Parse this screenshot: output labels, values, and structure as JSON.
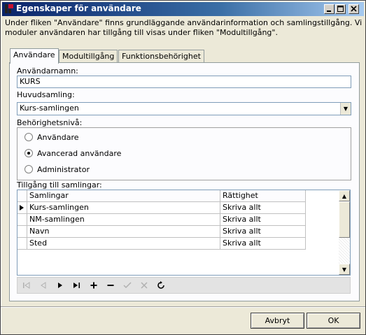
{
  "window": {
    "title": "Egenskaper för användare",
    "description_lines": [
      "Under fliken \"Användare\" finns grundläggande användarinformation och samlingstillgång. Vilka",
      "moduler användaren har tillgång till visas under fliken \"Modultillgång\"."
    ]
  },
  "tabs": [
    {
      "label": "Användare",
      "active": true
    },
    {
      "label": "Modultillgång",
      "active": false
    },
    {
      "label": "Funktionsbehörighet",
      "active": false
    }
  ],
  "form": {
    "username_label": "Användarnamn:",
    "username_value": "KURS",
    "main_collection_label": "Huvudsamling:",
    "main_collection_value": "Kurs-samlingen",
    "permission_label": "Behörighetsnivå:",
    "permission_options": [
      {
        "label": "Användare",
        "checked": false
      },
      {
        "label": "Avancerad användare",
        "checked": true
      },
      {
        "label": "Administrator",
        "checked": false
      }
    ],
    "access_label": "Tillgång till samlingar:"
  },
  "grid": {
    "headers": [
      "Samlingar",
      "Rättighet"
    ],
    "rows": [
      [
        "Kurs-samlingen",
        "Skriva allt"
      ],
      [
        "NM-samlingen",
        "Skriva allt"
      ],
      [
        "Navn",
        "Skriva allt"
      ],
      [
        "Sted",
        "Skriva allt"
      ]
    ],
    "current_row_index": 0
  },
  "navigator": {
    "icons": [
      "first-icon",
      "prev-icon",
      "next-icon",
      "last-icon",
      "add-icon",
      "delete-icon",
      "apply-icon",
      "cancel-edit-icon",
      "refresh-icon"
    ]
  },
  "buttons": {
    "cancel": "Avbryt",
    "ok": "OK"
  },
  "colors": {
    "titlebar_start": "#0a246a",
    "titlebar_end": "#a6caf0"
  }
}
